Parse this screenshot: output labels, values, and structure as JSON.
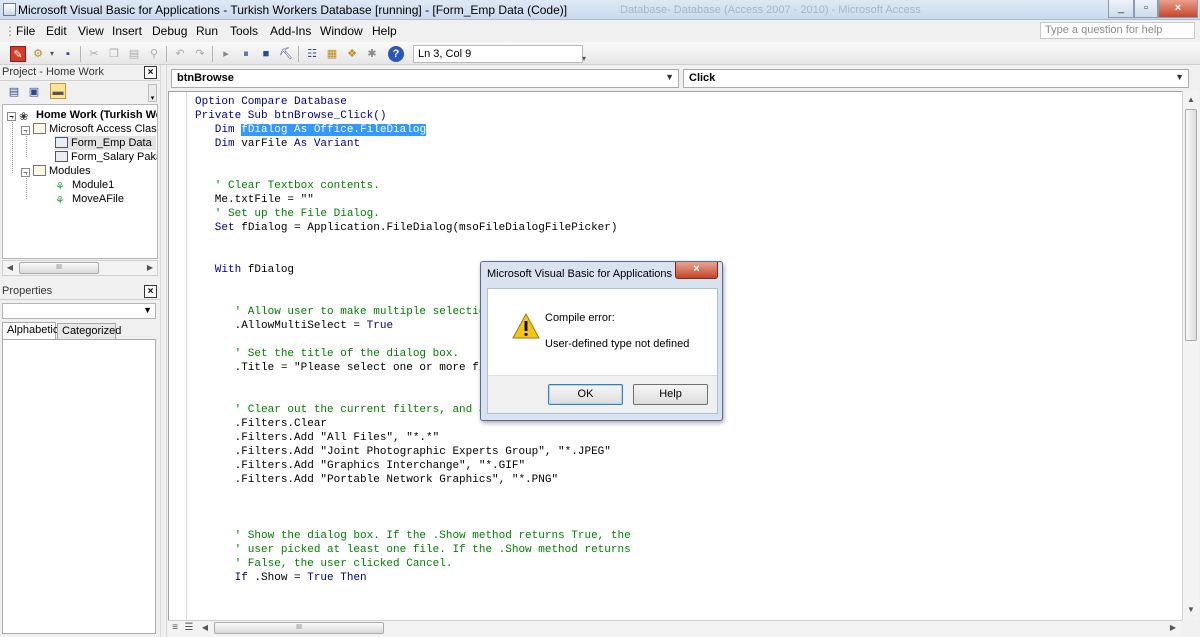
{
  "window": {
    "title": "Microsoft Visual Basic for Applications - Turkish Workers Database [running] - [Form_Emp Data (Code)]",
    "background_title": "Database- Database (Access 2007 - 2010) - Microsoft Access",
    "buttons": [
      "_",
      "▫",
      "×"
    ]
  },
  "menu": {
    "items": [
      "File",
      "Edit",
      "View",
      "Insert",
      "Debug",
      "Run",
      "Tools",
      "Add-Ins",
      "Window",
      "Help"
    ],
    "help_placeholder": "Type a question for help"
  },
  "toolbar": {
    "position": "Ln 3, Col 9"
  },
  "project": {
    "title": "Project - Home Work",
    "close": "×",
    "root": "Home Work (Turkish Wo",
    "folder_objects": "Microsoft Access Class O",
    "form_emp": "Form_Emp Data",
    "form_salary": "Form_Salary Pakage",
    "folder_modules": "Modules",
    "module1": "Module1",
    "movefile": "MoveAFile",
    "scroll_thumb": "III"
  },
  "properties": {
    "title": "Properties",
    "close": "×",
    "tab_alphabetic": "Alphabetic",
    "tab_categorized": "Categorized"
  },
  "code": {
    "object_combo": "btnBrowse",
    "proc_combo": "Click",
    "lines": [
      {
        "seg": [
          {
            "t": "Option Compare Database",
            "c": "kw"
          }
        ]
      },
      {
        "seg": [
          {
            "t": "Private Sub ",
            "c": "kw"
          },
          {
            "t": "btnBrowse_Click()",
            "c": "kw"
          }
        ]
      },
      {
        "seg": [
          {
            "t": "   Dim ",
            "c": "kw"
          },
          {
            "t": "fDialog As Office.FileDialog",
            "c": "sel"
          }
        ]
      },
      {
        "seg": [
          {
            "t": "   Dim ",
            "c": "kw"
          },
          {
            "t": "varFile ",
            "c": ""
          },
          {
            "t": "As Variant",
            "c": "kw"
          }
        ]
      },
      {
        "seg": []
      },
      {
        "seg": []
      },
      {
        "seg": [
          {
            "t": "   ' Clear Textbox contents.",
            "c": "cm"
          }
        ]
      },
      {
        "seg": [
          {
            "t": "   Me.txtFile = \"\"",
            "c": ""
          }
        ]
      },
      {
        "seg": [
          {
            "t": "   ' Set up the File Dialog.",
            "c": "cm"
          }
        ]
      },
      {
        "seg": [
          {
            "t": "   Set ",
            "c": "kw"
          },
          {
            "t": "fDialog = Application.FileDialog(msoFileDialogFilePicker)",
            "c": ""
          }
        ]
      },
      {
        "seg": []
      },
      {
        "seg": []
      },
      {
        "seg": [
          {
            "t": "   With ",
            "c": "kw"
          },
          {
            "t": "fDialog",
            "c": ""
          }
        ]
      },
      {
        "seg": []
      },
      {
        "seg": []
      },
      {
        "seg": [
          {
            "t": "      ' Allow user to make multiple selections in dialog box.",
            "c": "cm"
          }
        ]
      },
      {
        "seg": [
          {
            "t": "      .AllowMultiSelect = ",
            "c": ""
          },
          {
            "t": "True",
            "c": "kw"
          }
        ]
      },
      {
        "seg": []
      },
      {
        "seg": [
          {
            "t": "      ' Set the title of the dialog box.",
            "c": "cm"
          }
        ]
      },
      {
        "seg": [
          {
            "t": "      .Title = \"Please select one or more files\"",
            "c": ""
          }
        ]
      },
      {
        "seg": []
      },
      {
        "seg": []
      },
      {
        "seg": [
          {
            "t": "      ' Clear out the current filters, and add our own.",
            "c": "cm"
          }
        ]
      },
      {
        "seg": [
          {
            "t": "      .Filters.Clear",
            "c": ""
          }
        ]
      },
      {
        "seg": [
          {
            "t": "      .Filters.Add \"All Files\", \"*.*\"",
            "c": ""
          }
        ]
      },
      {
        "seg": [
          {
            "t": "      .Filters.Add \"Joint Photographic Experts Group\", \"*.JPEG\"",
            "c": ""
          }
        ]
      },
      {
        "seg": [
          {
            "t": "      .Filters.Add \"Graphics Interchange\", \"*.GIF\"",
            "c": ""
          }
        ]
      },
      {
        "seg": [
          {
            "t": "      .Filters.Add \"Portable Network Graphics\", \"*.PNG\"",
            "c": ""
          }
        ]
      },
      {
        "seg": []
      },
      {
        "seg": []
      },
      {
        "seg": []
      },
      {
        "seg": [
          {
            "t": "      ' Show the dialog box. If the .Show method returns True, the",
            "c": "cm"
          }
        ]
      },
      {
        "seg": [
          {
            "t": "      ' user picked at least one file. If the .Show method returns",
            "c": "cm"
          }
        ]
      },
      {
        "seg": [
          {
            "t": "      ' False, the user clicked Cancel.",
            "c": "cm"
          }
        ]
      },
      {
        "seg": [
          {
            "t": "      If ",
            "c": "kw"
          },
          {
            "t": ".Show = ",
            "c": ""
          },
          {
            "t": "True Then",
            "c": "kw"
          }
        ]
      }
    ],
    "hscroll_thumb": "III"
  },
  "dialog": {
    "title": "Microsoft Visual Basic for Applications",
    "close": "×",
    "heading": "Compile error:",
    "message": "User-defined type not defined",
    "ok": "OK",
    "help": "Help"
  },
  "colors": {
    "keyword": "#00008b",
    "comment": "#008000",
    "selection": "#3399ff"
  }
}
